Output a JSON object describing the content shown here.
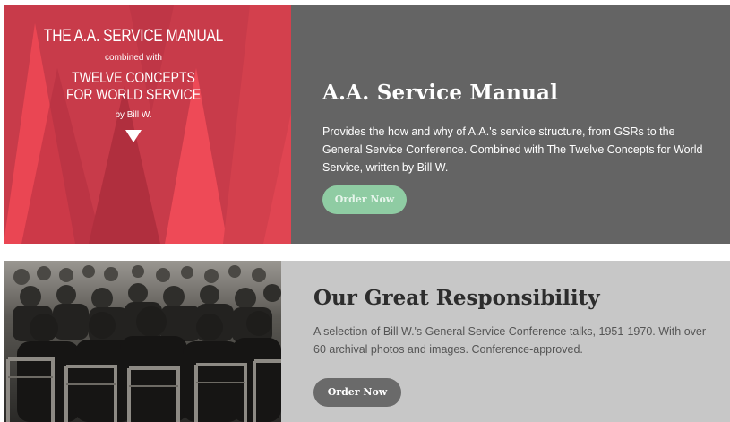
{
  "products": [
    {
      "cover": {
        "title": "THE A.A. SERVICE MANUAL",
        "combined": "combined with",
        "subtitle_line1": "TWELVE CONCEPTS",
        "subtitle_line2": "FOR WORLD SERVICE",
        "author": "by Bill W."
      },
      "title": "A.A. Service Manual",
      "description": "Provides the how and why of A.A.'s service structure, from GSRs to the General Service Conference. Combined with The Twelve Concepts for World Service, written by Bill W.",
      "button_label": "Order Now",
      "button_color": "#8fcca3"
    },
    {
      "title": "Our Great Responsibility",
      "description": "A selection of Bill W.'s General Service Conference talks, 1951-1970. With over 60 archival photos and images. Conference-approved.",
      "button_label": "Order Now",
      "button_color": "#6a6a6a"
    }
  ]
}
